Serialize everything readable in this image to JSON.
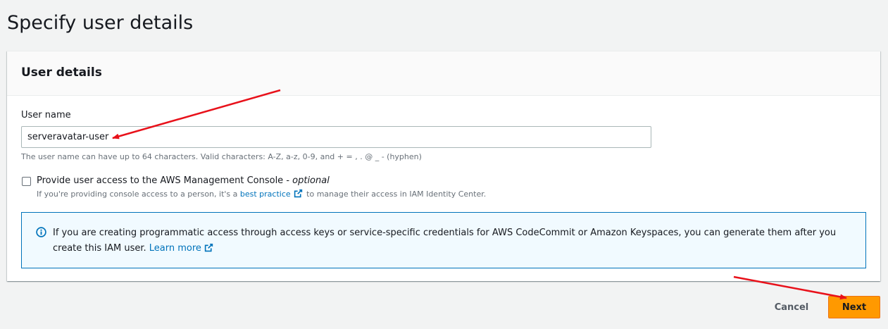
{
  "page": {
    "title": "Specify user details"
  },
  "panel": {
    "title": "User details",
    "username": {
      "label": "User name",
      "value": "serveravatar-user",
      "hint": "The user name can have up to 64 characters. Valid characters: A-Z, a-z, 0-9, and + = , . @ _ - (hyphen)"
    },
    "console_access": {
      "label": "Provide user access to the AWS Management Console - ",
      "optional": "optional",
      "checked": false,
      "desc_before": "If you're providing console access to a person, it's a ",
      "desc_link": "best practice",
      "desc_after": " to manage their access in IAM Identity Center."
    },
    "info": {
      "text": "If you are creating programmatic access through access keys or service-specific credentials for AWS CodeCommit or Amazon Keyspaces, you can generate them after you create this IAM user. ",
      "link": "Learn more"
    }
  },
  "footer": {
    "cancel_label": "Cancel",
    "next_label": "Next"
  },
  "colors": {
    "primary_button": "#ff9900",
    "link": "#0073bb",
    "annotation_arrow": "#e8111a"
  },
  "icons": [
    "external-link-icon",
    "info-icon"
  ]
}
